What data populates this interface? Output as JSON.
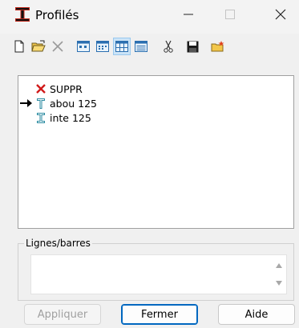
{
  "window": {
    "title": "Profilés",
    "icons": {
      "app": "beam-app-icon",
      "minimize": "minimize-icon",
      "maximize": "maximize-icon",
      "close": "close-icon"
    }
  },
  "toolbar": {
    "tools": [
      {
        "name": "new-doc-icon"
      },
      {
        "name": "open-folder-icon"
      },
      {
        "name": "delete-x-icon"
      },
      {
        "name": "view-small-icons-icon"
      },
      {
        "name": "view-list-icon"
      },
      {
        "name": "view-grid-icon",
        "pressed": true
      },
      {
        "name": "view-details-icon"
      },
      {
        "name": "scissors-icon"
      },
      {
        "name": "save-disk-icon"
      },
      {
        "name": "folder-star-icon"
      }
    ]
  },
  "profiles": {
    "items": [
      {
        "label": "SUPPR",
        "icon": "red-x-icon",
        "current": false
      },
      {
        "label": "abou 125",
        "icon": "t-beam-icon",
        "current": true
      },
      {
        "label": "inte 125",
        "icon": "t-beam-icon",
        "current": false
      }
    ]
  },
  "lines_group": {
    "label": "Lignes/barres",
    "value": ""
  },
  "buttons": {
    "apply": "Appliquer",
    "close": "Fermer",
    "help": "Aide"
  },
  "colors": {
    "background": "#f0f0f0",
    "accent": "#0067c0",
    "delete_red": "#d11a1a",
    "beam_teal": "#2a8aa0"
  }
}
